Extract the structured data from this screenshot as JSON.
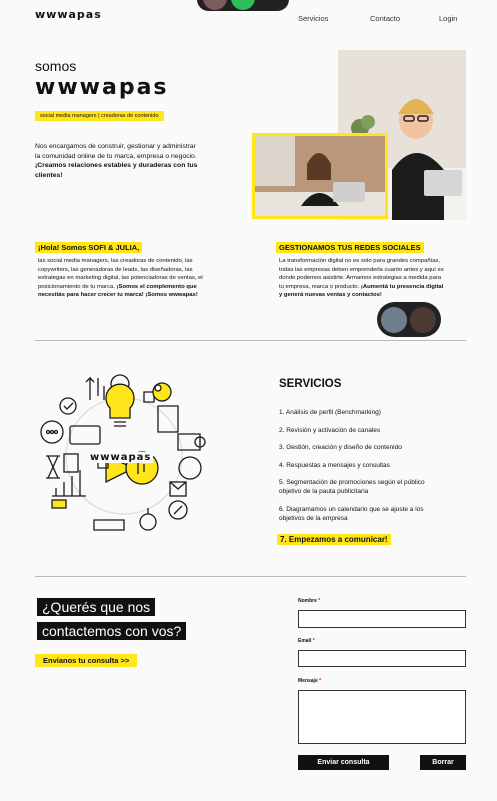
{
  "header": {
    "brand": "wwwapas",
    "nav": [
      "Servicios",
      "Contacto",
      "Login"
    ]
  },
  "hero": {
    "somos": "somos",
    "brand": "wwwapas",
    "tagline": "social media managers | creadoras de contenido",
    "intro_plain": "Nos encargamos de construir, gestionar y administrar la comunidad online de tu marca, empresa o negocio. ",
    "intro_bold": "¡Creamos relaciones estables y duraderas con tus clientes!"
  },
  "about": {
    "title": "¡Hola! Somos SOFI & JULIA,",
    "text_plain": "las social media managers, las creadoras de contenido, las copywriters, las generadoras de leads, las diseñadoras, las estrategas en marketing digital, las potenciadoras de ventas, el posicionamiento de tu marca. ",
    "text_bold": "¡Somos el complemento que necesitás para hacer crecer tu marca! ¡Somos wwwapas!"
  },
  "manage": {
    "title": "GESTIONAMOS TUS REDES SOCIALES",
    "text_plain": "La transformación digital no es solo para grandes compañías, todas las empresas deben emprenderla cuanto antes y aquí es donde podemos asistirte. Armamos estrategias a medida para tu empresa, marca o producto. ",
    "text_bold": "¡Aumentá tu presencia digital y generá nuevas ventas y contactos!"
  },
  "illustration": {
    "brand": "wwwapas"
  },
  "services": {
    "title": "SERVICIOS",
    "items": [
      "1. Análisis de perfil (Benchmarking)",
      "2. Revisión y activación de canales",
      "3. Gestión, creación y diseño de contenido",
      "4. Respuestas a mensajes y consultas",
      "5. Segmentación de promociones según el público objetivo de la pauta publicitaria",
      "6. Diagramamos un calendario que se ajuste a los objetivos de la empresa"
    ],
    "last": "7. Empezamos a comunicar!"
  },
  "contact": {
    "line1": "¿Querés que nos",
    "line2": "contactemos con vos?",
    "cta": "Envianos tu consulta >>",
    "name_label": "Nombre",
    "email_label": "Email",
    "message_label": "Mensaje",
    "required_mark": "*",
    "submit": "Enviar consulta",
    "reset": "Borrar"
  },
  "colors": {
    "accent": "#ffe51a",
    "dark": "#111111",
    "background": "#fafafa"
  }
}
